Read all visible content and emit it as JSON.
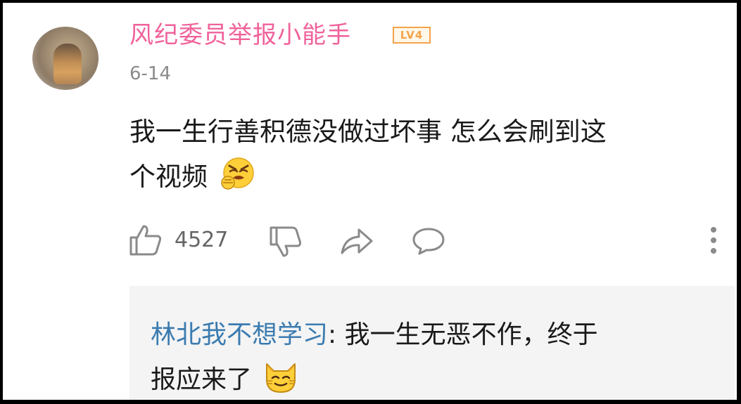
{
  "comment": {
    "username": "风纪委员举报小能手",
    "level_badge": "LV4",
    "date": "6-14",
    "text_line1": "我一生行善积德没做过坏事 怎么会刷到这",
    "text_line2": "个视频",
    "emoji": "disgust-emoji",
    "like_count": "4527"
  },
  "reply": {
    "author": "林北我不想学习",
    "separator": ": ",
    "text_line1": "我一生无恶不作，终于",
    "text_line2": "报应来了",
    "emoji": "smirk-cat-emoji"
  },
  "colors": {
    "username": "#f0629b",
    "reply_author": "#3b7bb0",
    "level_badge": "#f3a44a",
    "icon_gray": "#8a8a8a"
  }
}
